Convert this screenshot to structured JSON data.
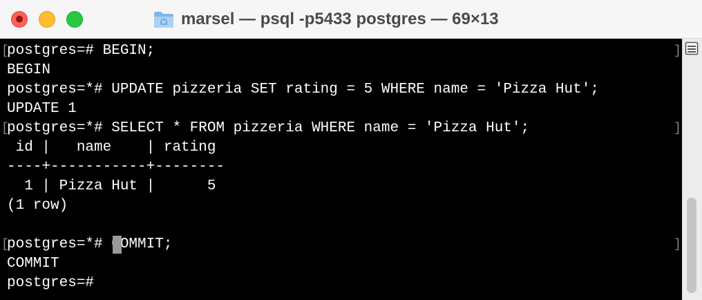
{
  "window": {
    "title": "marsel — psql -p5433 postgres — 69×13",
    "icons": {
      "close": "close-icon",
      "folder": "folder-icon",
      "split": "split-pane-icon"
    }
  },
  "terminal": {
    "lines": [
      "postgres=# BEGIN;",
      "BEGIN",
      "postgres=*# UPDATE pizzeria SET rating = 5 WHERE name = 'Pizza Hut';",
      "UPDATE 1",
      "postgres=*# SELECT * FROM pizzeria WHERE name = 'Pizza Hut';",
      " id |   name    | rating",
      "----+-----------+--------",
      "  1 | Pizza Hut |      5",
      "(1 row)",
      "",
      "postgres=*# COMMIT;",
      "COMMIT",
      "postgres=# "
    ],
    "mark_open": "[",
    "mark_close": "]"
  },
  "colors": {
    "background": "#000000",
    "text": "#ffffff",
    "cursor": "#9a9a9a"
  }
}
